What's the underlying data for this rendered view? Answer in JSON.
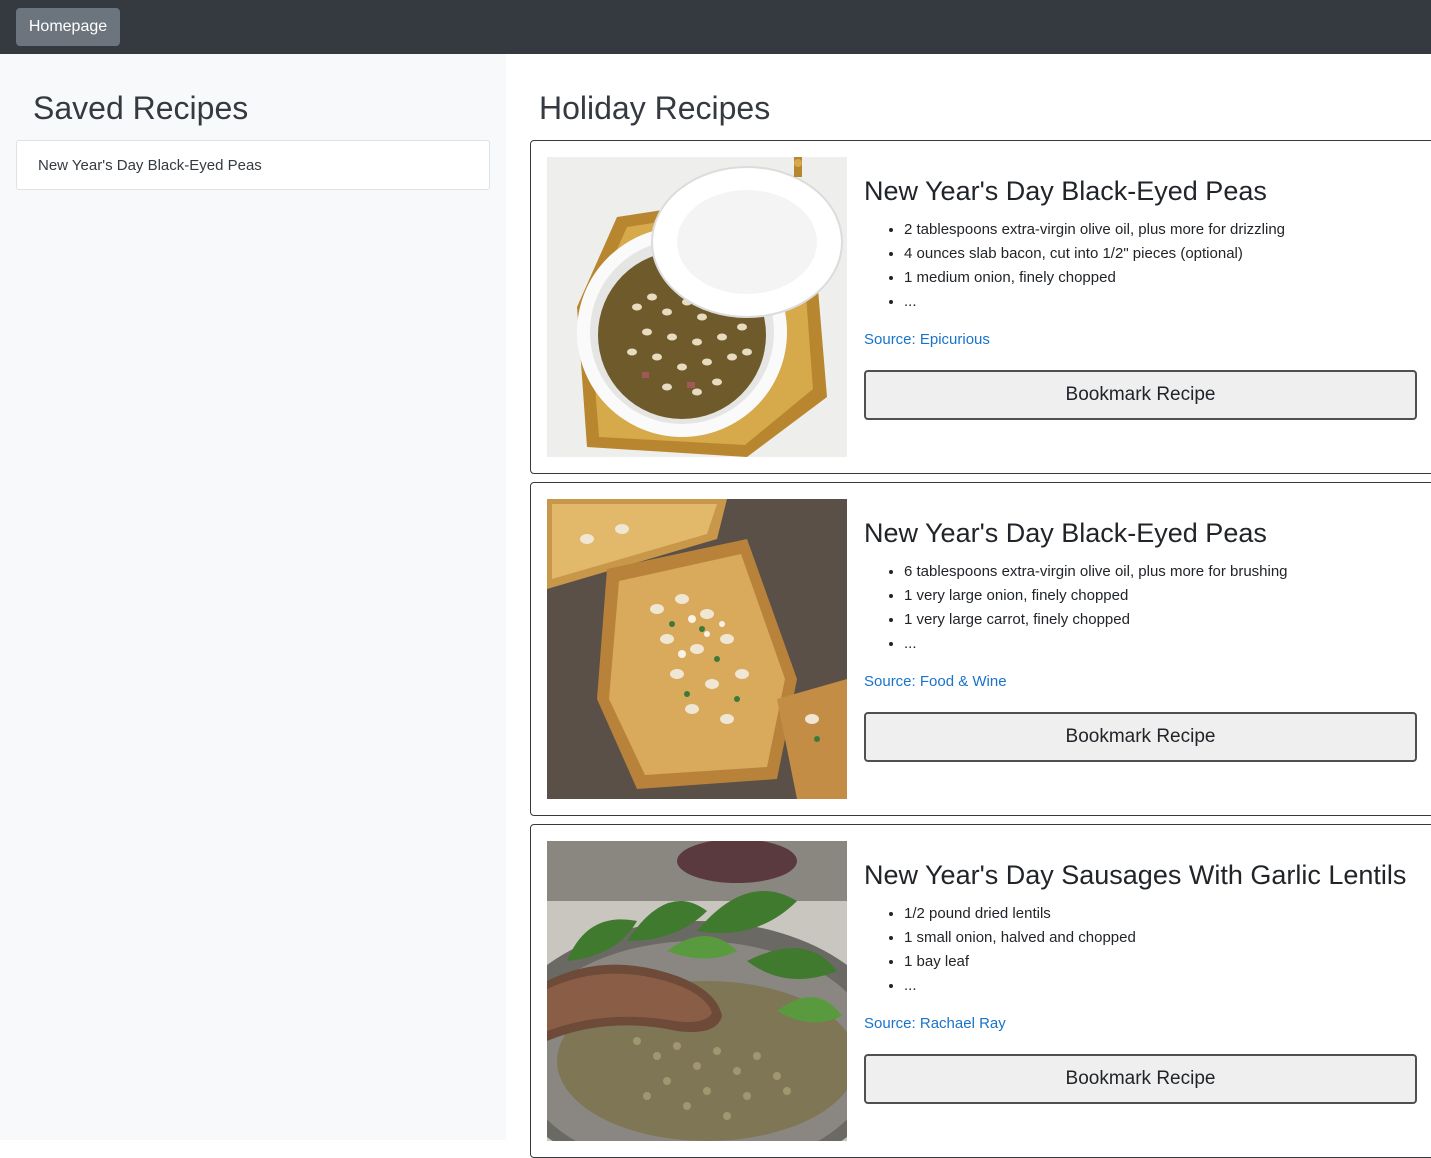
{
  "navbar": {
    "home_label": "Homepage"
  },
  "sidebar": {
    "title": "Saved Recipes",
    "saved": [
      {
        "label": "New Year's Day Black-Eyed Peas"
      }
    ]
  },
  "main": {
    "title": "Holiday Recipes",
    "recipes": [
      {
        "title": "New Year's Day Black-Eyed Peas",
        "ingredients": [
          "2 tablespoons extra-virgin olive oil, plus more for drizzling",
          "4 ounces slab bacon, cut into 1/2\" pieces (optional)",
          "1 medium onion, finely chopped",
          "..."
        ],
        "source": "Source: Epicurious",
        "button": "Bookmark Recipe",
        "image_icon": "bowl-of-black-eyed-peas"
      },
      {
        "title": "New Year's Day Black-Eyed Peas",
        "ingredients": [
          "6 tablespoons extra-virgin olive oil, plus more for brushing",
          "1 very large onion, finely chopped",
          "1 very large carrot, finely chopped",
          "..."
        ],
        "source": "Source: Food & Wine",
        "button": "Bookmark Recipe",
        "image_icon": "toast-with-black-eyed-peas"
      },
      {
        "title": "New Year's Day Sausages With Garlic Lentils",
        "ingredients": [
          "1/2 pound dried lentils",
          "1 small onion, halved and chopped",
          "1 bay leaf",
          "..."
        ],
        "source": "Source: Rachael Ray",
        "button": "Bookmark Recipe",
        "image_icon": "sausages-with-lentils"
      }
    ]
  },
  "colors": {
    "navbar": "#343a40",
    "home_button": "#6c757d",
    "sidebar": "#f8f9fa",
    "link": "#1a73c9"
  }
}
